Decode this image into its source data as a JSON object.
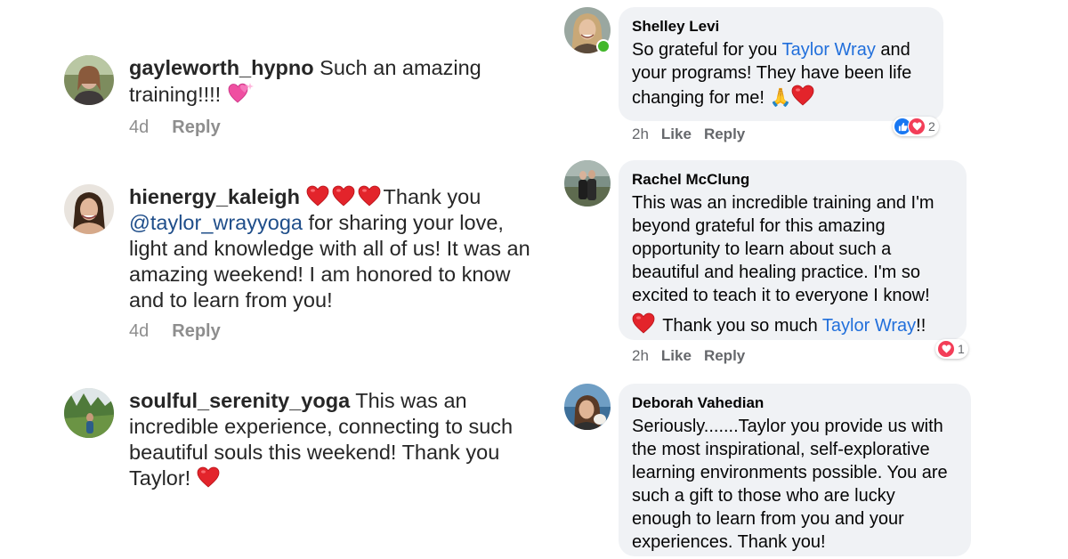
{
  "instagram": {
    "comments": [
      {
        "username": "gayleworth_hypno",
        "text": " Such an amazing training!!!! ",
        "emoji": "sparkling-heart",
        "age": "4d",
        "reply_label": "Reply"
      },
      {
        "username": "hienergy_kaleigh",
        "text_after_hearts": "Thank you ",
        "mention": "@taylor_wrayyoga",
        "text_rest": " for sharing your love, light and knowledge with all of us! It was an amazing weekend! I am honored to know and to learn from you!",
        "emoji": "red-heart x3",
        "age": "4d",
        "reply_label": "Reply"
      },
      {
        "username": "soulful_serenity_yoga",
        "text": " This was an incredible experience,  connecting to such beautiful souls this weekend! Thank you Taylor! ",
        "emoji": "red-heart",
        "age": null,
        "reply_label": null
      }
    ]
  },
  "facebook": {
    "comments": [
      {
        "name": "Shelley Levi",
        "text_before_link": "So grateful for you ",
        "link": "Taylor Wray",
        "text_after_link": " and your programs! They have been life changing for me! ",
        "emoji": "folded-hands, red-heart",
        "time": "2h",
        "like_label": "Like",
        "reply_label": "Reply",
        "reaction_count": "2",
        "online": true
      },
      {
        "name": "Rachel McClung",
        "text": "This was an incredible training and I'm beyond grateful for this amazing opportunity to learn about such a beautiful and healing practice. I'm so excited to teach it to everyone I know!",
        "text2_before_link": " Thank you so much ",
        "link": "Taylor Wray",
        "text2_after_link": "!!",
        "emoji": "red-heart",
        "time": "2h",
        "like_label": "Like",
        "reply_label": "Reply",
        "reaction_count": "1"
      },
      {
        "name": "Deborah Vahedian",
        "text": "Seriously.......Taylor you provide us with the most inspirational, self-explorative learning environments possible.  You are such a gift to those who are lucky enough to learn from you and your experiences.  Thank you!"
      }
    ]
  },
  "colors": {
    "ig_text": "#262626",
    "ig_meta": "#8e8e8e",
    "ig_mention": "#1f4e8a",
    "fb_bubble": "#f0f2f5",
    "fb_link": "#216fdb",
    "fb_meta": "#65676b",
    "heart": "#e3242b"
  }
}
